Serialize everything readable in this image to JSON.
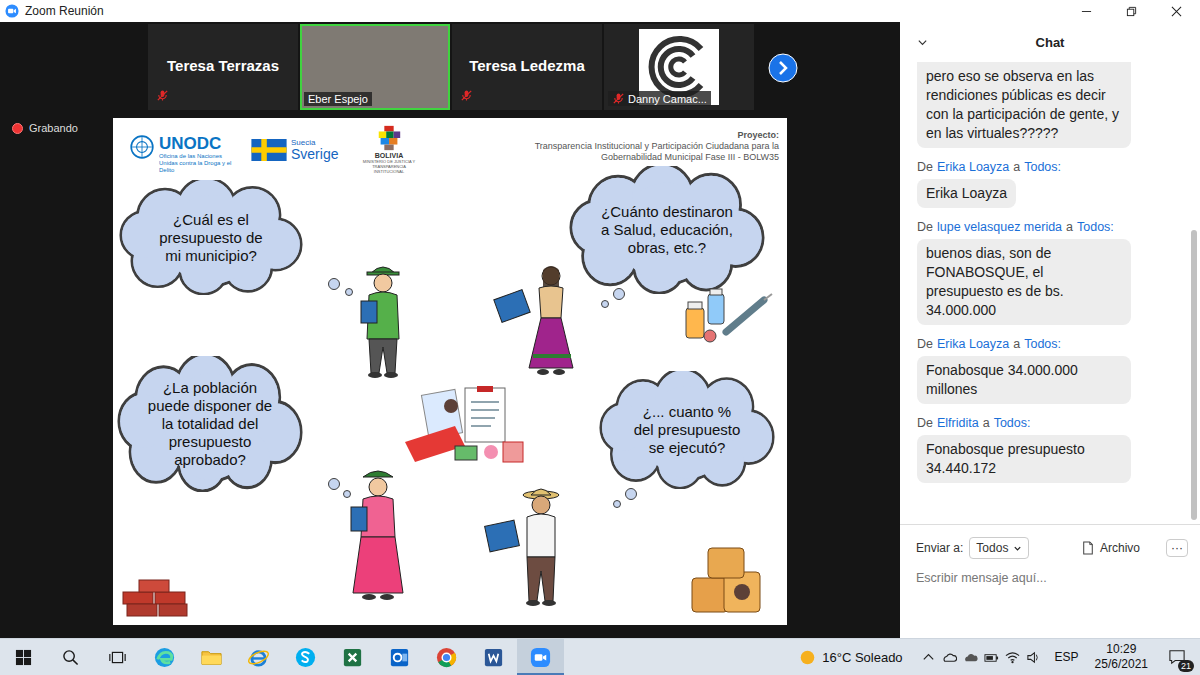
{
  "window": {
    "title": "Zoom Reunión"
  },
  "participants": [
    {
      "name": "Teresa Terrazas",
      "kind": "name",
      "muted": true,
      "speaking": false
    },
    {
      "name": "Eber Espejo",
      "kind": "video",
      "muted": false,
      "speaking": true
    },
    {
      "name": "Teresa Ledezma",
      "kind": "name",
      "muted": true,
      "speaking": false
    },
    {
      "name": "Danny Camac...",
      "kind": "avatar",
      "muted": true,
      "speaking": false
    }
  ],
  "recording": {
    "label": "Grabando",
    "on": true
  },
  "slide": {
    "logos": {
      "unodc": "UNODC",
      "unodc_sub": "Oficina de las Naciones Unidas contra la Droga y el Delito",
      "sweden_top": "Suecia",
      "sweden": "Sverige",
      "bolivia": "BOLIVIA",
      "bolivia_sub": "MINISTERIO DE JUSTICIA Y TRANSPARENCIA INSTITUCIONAL"
    },
    "project": {
      "label": "Proyecto:",
      "lines": [
        "Transparencia Institucional y Participación Ciudadana para la",
        "Gobernabilidad Municipal  Fase III - BOLW35"
      ]
    },
    "questions": [
      "¿Cuál es el presupuesto de mi municipio?",
      "¿Cuánto destinaron a Salud, educación, obras, etc.?",
      "¿La población puede disponer de la totalidad del presupuesto aprobado?",
      "¿... cuanto % del presupuesto se ejecutó?"
    ]
  },
  "chat": {
    "title": "Chat",
    "from_word": "De",
    "to_word": "a",
    "partial_message": "pero eso se observa en las rendiciones públicas es decir con la participación de gente, y en las virtuales?????",
    "messages": [
      {
        "sender": "Erika Loayza",
        "recipient": "Todos:",
        "text": "Erika Loayza"
      },
      {
        "sender": "lupe velasquez merida",
        "recipient": "Todos:",
        "text": "buenos dias, son de FONABOSQUE, el presupuesto es de bs. 34.000.000"
      },
      {
        "sender": "Erika Loayza",
        "recipient": "Todos:",
        "text": "Fonabosque 34.000.000 millones"
      },
      {
        "sender": "Elfridita",
        "recipient": "Todos:",
        "text": "Fonabosque presupuesto 34.440.172"
      }
    ],
    "send_to": {
      "label": "Enviar a:",
      "value": "Todos"
    },
    "file": "Archivo",
    "more": "···",
    "input": {
      "placeholder": "Escribir mensaje aquí..."
    }
  },
  "taskbar": {
    "apps": [
      {
        "kind": "edge",
        "active": false
      },
      {
        "kind": "explorer",
        "active": false
      },
      {
        "kind": "ie",
        "active": false
      },
      {
        "kind": "skype",
        "active": false
      },
      {
        "kind": "excel",
        "active": false
      },
      {
        "kind": "outlook",
        "active": false
      },
      {
        "kind": "chrome",
        "active": false
      },
      {
        "kind": "word",
        "active": false
      },
      {
        "kind": "zoom",
        "active": true
      }
    ],
    "weather": "16°C Soleado",
    "language": "ESP",
    "time": "10:29",
    "date": "25/6/2021",
    "notifications": "21"
  }
}
